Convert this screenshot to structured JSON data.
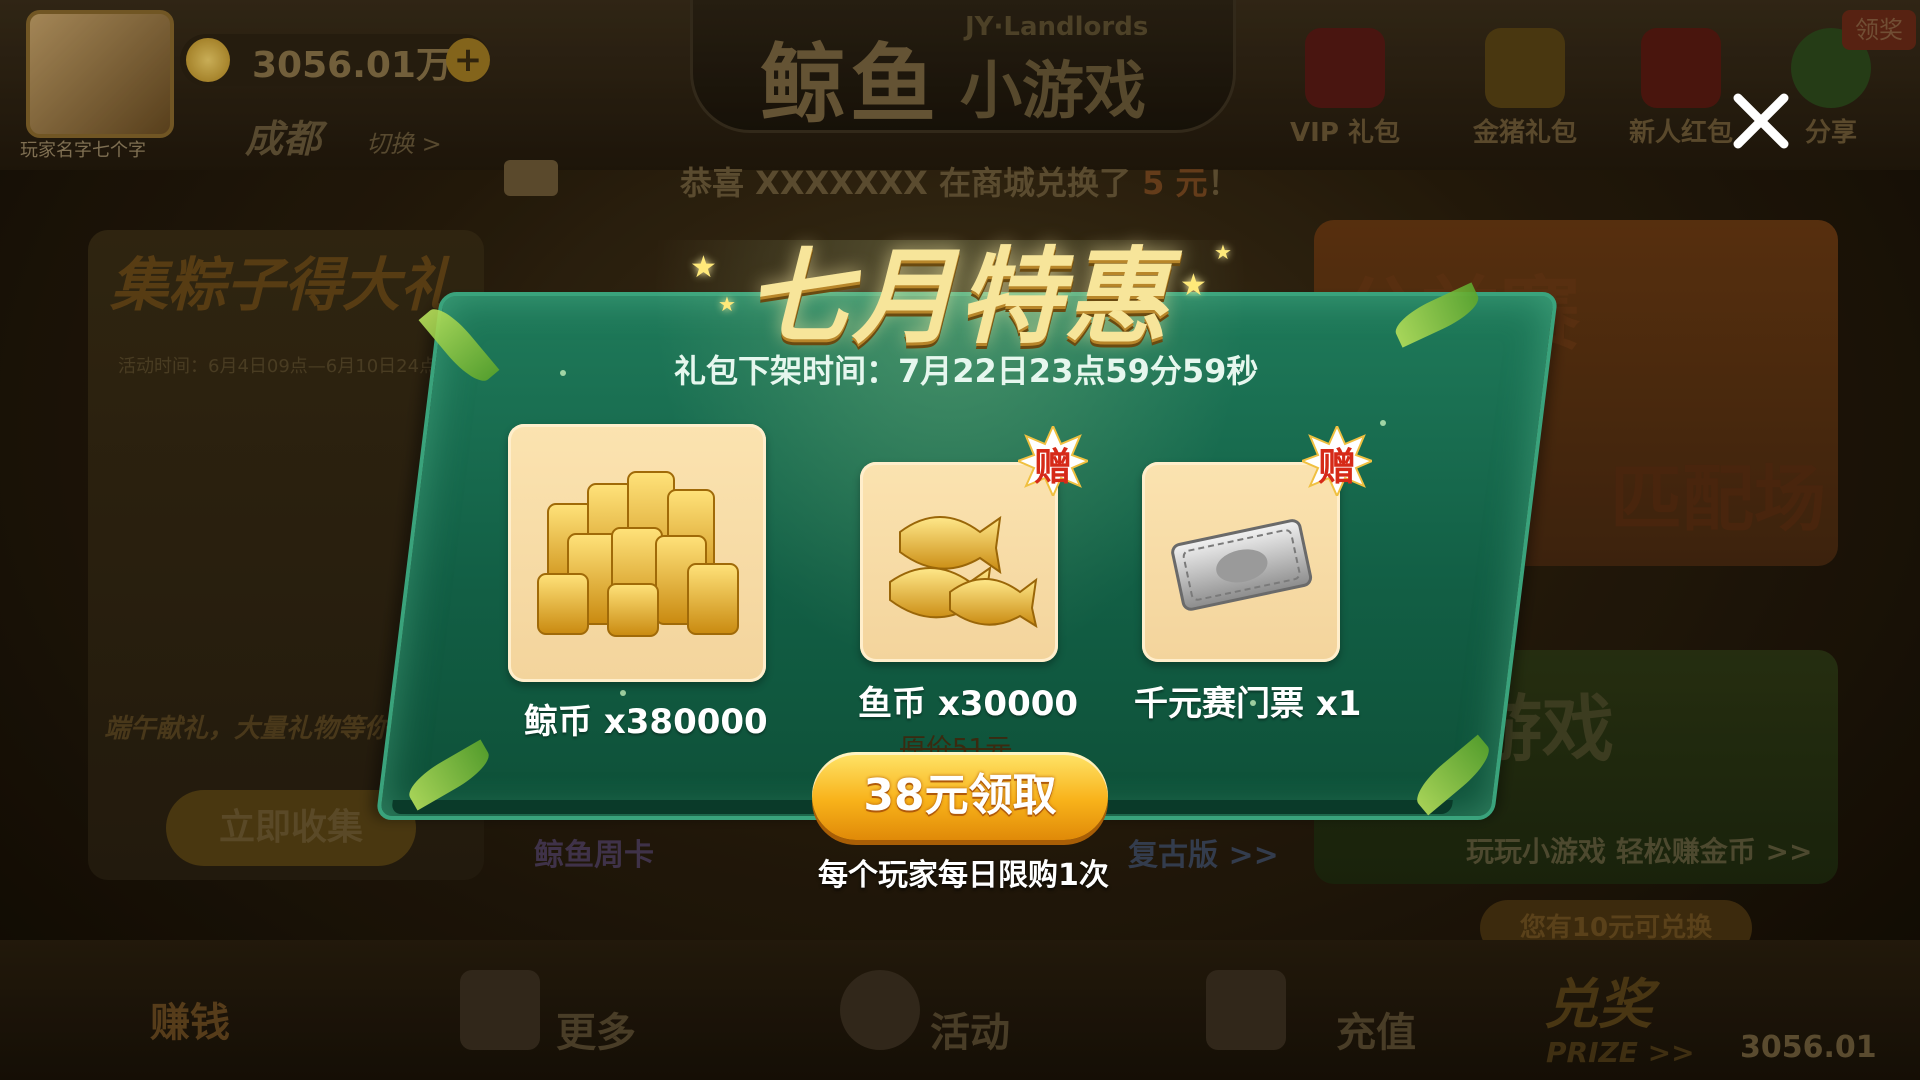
{
  "topbar": {
    "player_name": "玩家名字七个字",
    "coin_amount": "3056.01万",
    "city": "成都",
    "switch_label": "切换 >",
    "logo_main": "鲸鱼",
    "logo_sub": "小游戏",
    "logo_en": "JY·Landlords",
    "items": [
      {
        "label": "VIP 礼包",
        "icon": "crown-icon"
      },
      {
        "label": "金猪礼包",
        "icon": "pig-icon"
      },
      {
        "label": "新人红包",
        "icon": "red-envelope-icon"
      },
      {
        "label": "分享",
        "icon": "wechat-icon"
      }
    ],
    "receive_tag": "领奖"
  },
  "notice": {
    "prefix": "恭喜 XXXXXXX 在商城兑换了 ",
    "amount": "5 元",
    "suffix": "！"
  },
  "left_panel": {
    "title": "集粽子得大礼",
    "time": "活动时间：6月4日09点—6月10日24点",
    "desc": "端午献礼，大量礼物等你",
    "button": "立即收集"
  },
  "right_panel": {
    "title": "公益赛",
    "subtitle": "匹配场",
    "game_title": "游戏",
    "game_sub": "玩玩小游戏 轻松赚金币 >>"
  },
  "center_labels": {
    "week_card": "鲸鱼周卡",
    "retro": "复古版 >>"
  },
  "bottom_nav": [
    {
      "label": "更多",
      "icon": "grid-icon"
    },
    {
      "label": "活动",
      "icon": "activity-icon"
    },
    {
      "label": "充值",
      "icon": "cart-icon"
    }
  ],
  "earn_label": "赚钱",
  "prize": {
    "tag": "您有10元可兑换",
    "label": "兑奖",
    "en": "PRIZE >>",
    "coin": "3056.01"
  },
  "dialog": {
    "title": "七月特惠",
    "deadline": "礼包下架时间：7月22日23点59分59秒",
    "items": [
      {
        "label": "鲸币 x380000",
        "icon": "gold-coins-icon",
        "gift": ""
      },
      {
        "label": "鱼币 x30000",
        "icon": "gold-fish-icon",
        "gift": "赠"
      },
      {
        "label": "千元赛门票 x1",
        "icon": "ticket-icon",
        "gift": "赠"
      }
    ],
    "original_price": "原价51元",
    "buy_button": "38元领取",
    "limit_text": "每个玩家每日限购1次"
  },
  "colors": {
    "dialog_green": "#1f7a5a",
    "button_gold": "#f8b21a",
    "title_gold": "#f7e59a",
    "gift_red": "#d62a18"
  }
}
